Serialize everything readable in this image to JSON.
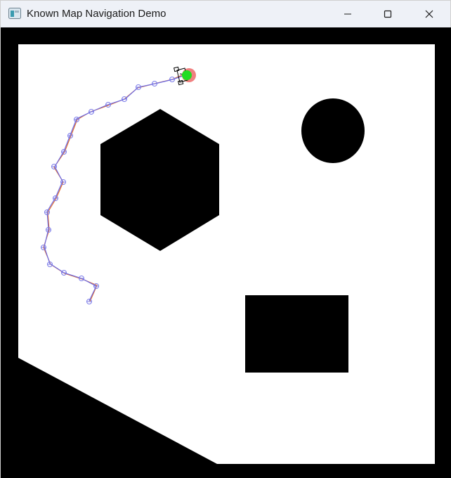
{
  "window": {
    "title": "Known Map Navigation Demo",
    "app_icon": "app-window-icon",
    "controls": {
      "minimize_icon": "minimize-icon",
      "maximize_icon": "maximize-icon",
      "close_icon": "close-icon"
    }
  },
  "map": {
    "background_color": "#000000",
    "free_space_color": "#ffffff",
    "obstacle_color": "#000000",
    "obstacles": [
      "hexagon",
      "circle",
      "rectangle",
      "bottom-left-wedge"
    ],
    "path_colors": {
      "planned": "#6a6ae6",
      "traveled": "#e26b2a",
      "waypoint": "#7c7ce8"
    },
    "robot": {
      "body_color": "#22dd22",
      "halo_color": "#f08080",
      "outline_color": "#000000"
    }
  }
}
